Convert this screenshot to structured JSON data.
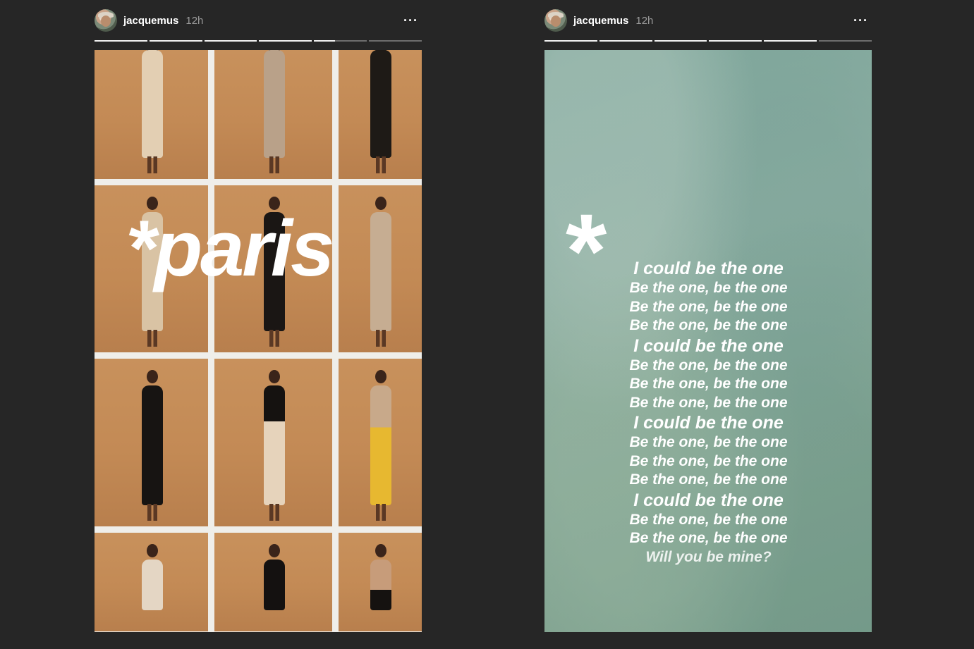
{
  "stories": [
    {
      "username": "jacquemus",
      "time": "12h",
      "more_label": "···",
      "progress": [
        1,
        1,
        1,
        1,
        0.4,
        0
      ],
      "overlay_text": "*paris"
    },
    {
      "username": "jacquemus",
      "time": "12h",
      "more_label": "···",
      "progress": [
        1,
        1,
        1,
        1,
        1,
        0
      ],
      "asterisk": "*",
      "lyrics": [
        "I could be the one",
        "Be the one, be the one",
        "Be the one, be the one",
        "Be the one, be the one",
        "I could be the one",
        "Be the one, be the one",
        "Be the one, be the one",
        "Be the one, be the one",
        "I could be the one",
        "Be the one, be the one",
        "Be the one, be the one",
        "Be the one, be the one",
        "I could be the one",
        "Be the one, be the one",
        "Be the one, be the one",
        "Will you be mine?"
      ]
    }
  ],
  "colors": {
    "background": "#262626",
    "progress_filled": "#f2f2f2",
    "progress_empty": "#6d6d6d",
    "kraft_paper": "#c38a55",
    "lyrics_teal": "#8eafa3"
  },
  "icons": [
    "avatar",
    "more-icon"
  ]
}
